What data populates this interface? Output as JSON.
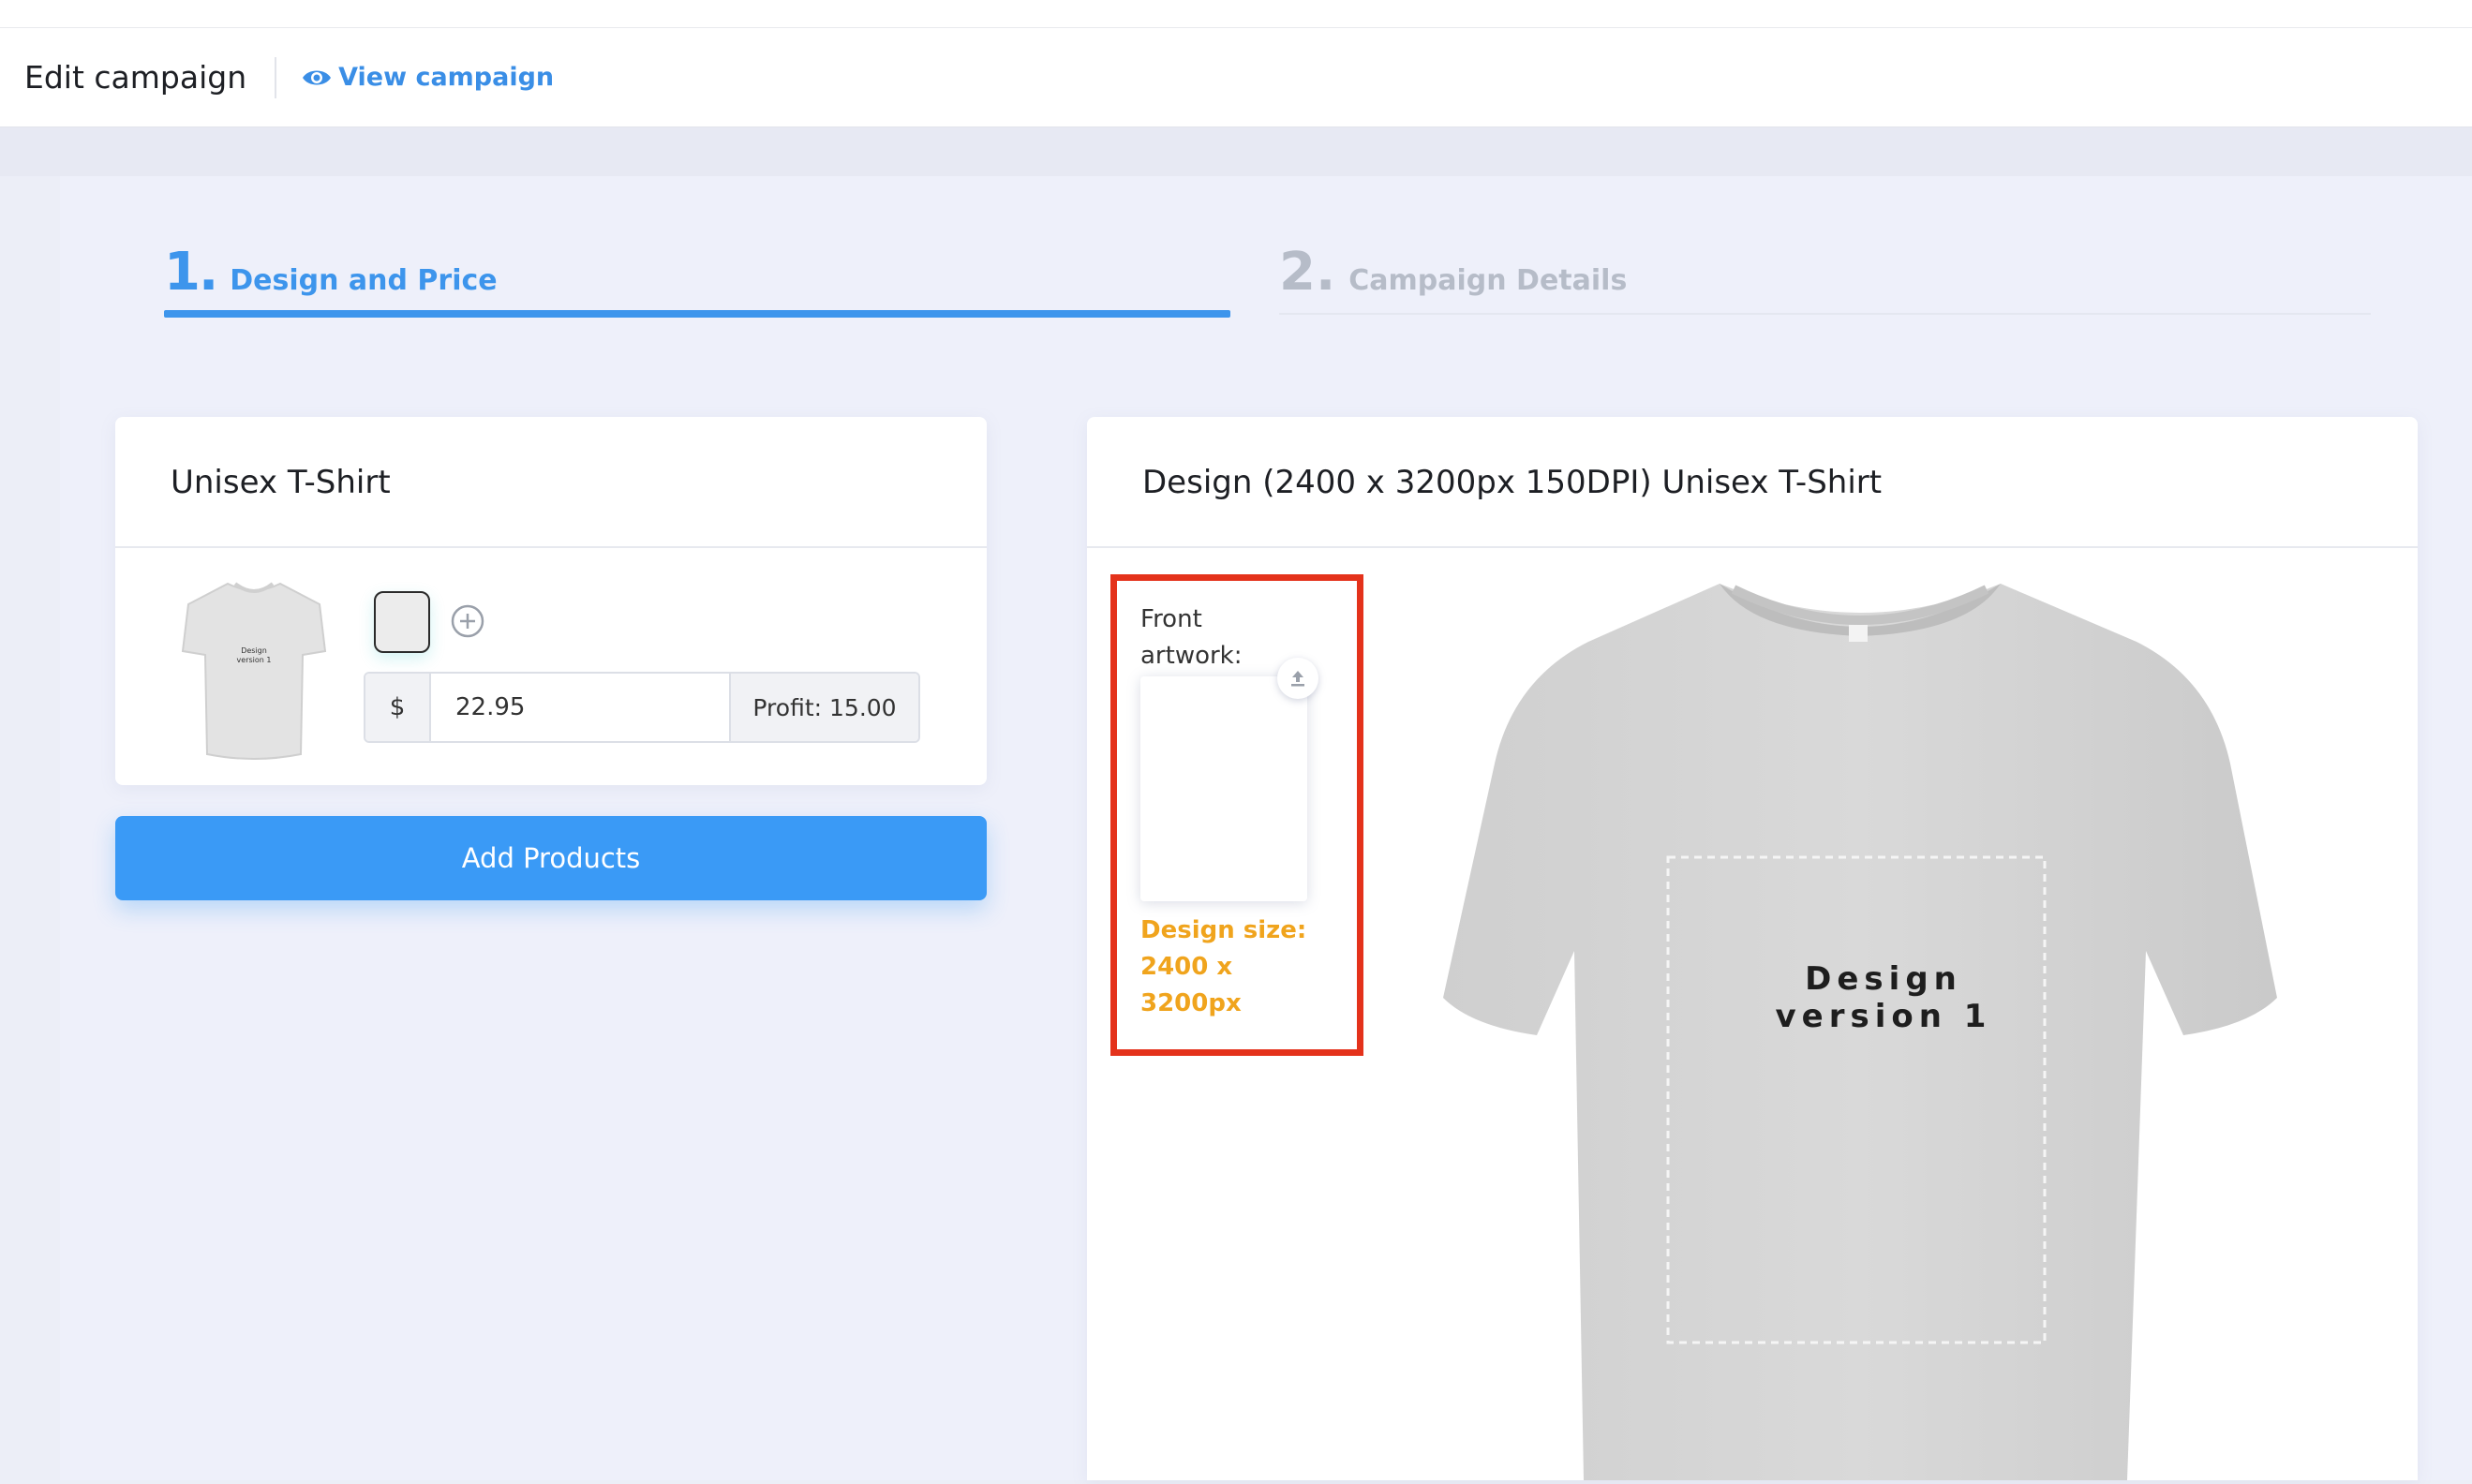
{
  "header": {
    "title": "Edit campaign",
    "view_link": "View campaign"
  },
  "steps": [
    {
      "number": "1.",
      "label": "Design and Price",
      "active": true
    },
    {
      "number": "2.",
      "label": "Campaign Details",
      "active": false
    }
  ],
  "product_card": {
    "title": "Unisex T-Shirt",
    "thumbnail_text": "Design version 1",
    "color_swatch": "#ececec",
    "currency": "$",
    "price": "22.95",
    "profit": "Profit: 15.00"
  },
  "add_products_label": "Add Products",
  "design_card": {
    "title": "Design (2400 x 3200px 150DPI) Unisex T-Shirt",
    "artwork_label": "Front artwork:",
    "design_size": "Design size: 2400 x 3200px",
    "preview_text_line1": "Design",
    "preview_text_line2": "version 1"
  },
  "colors": {
    "accent": "#3d95ec",
    "button": "#3a9af6",
    "highlight_border": "#e4321b",
    "design_size_text": "#f0a41d",
    "inactive_step": "#b6bcc8"
  },
  "icons": [
    "eye-icon",
    "plus-circle-icon",
    "upload-icon"
  ]
}
